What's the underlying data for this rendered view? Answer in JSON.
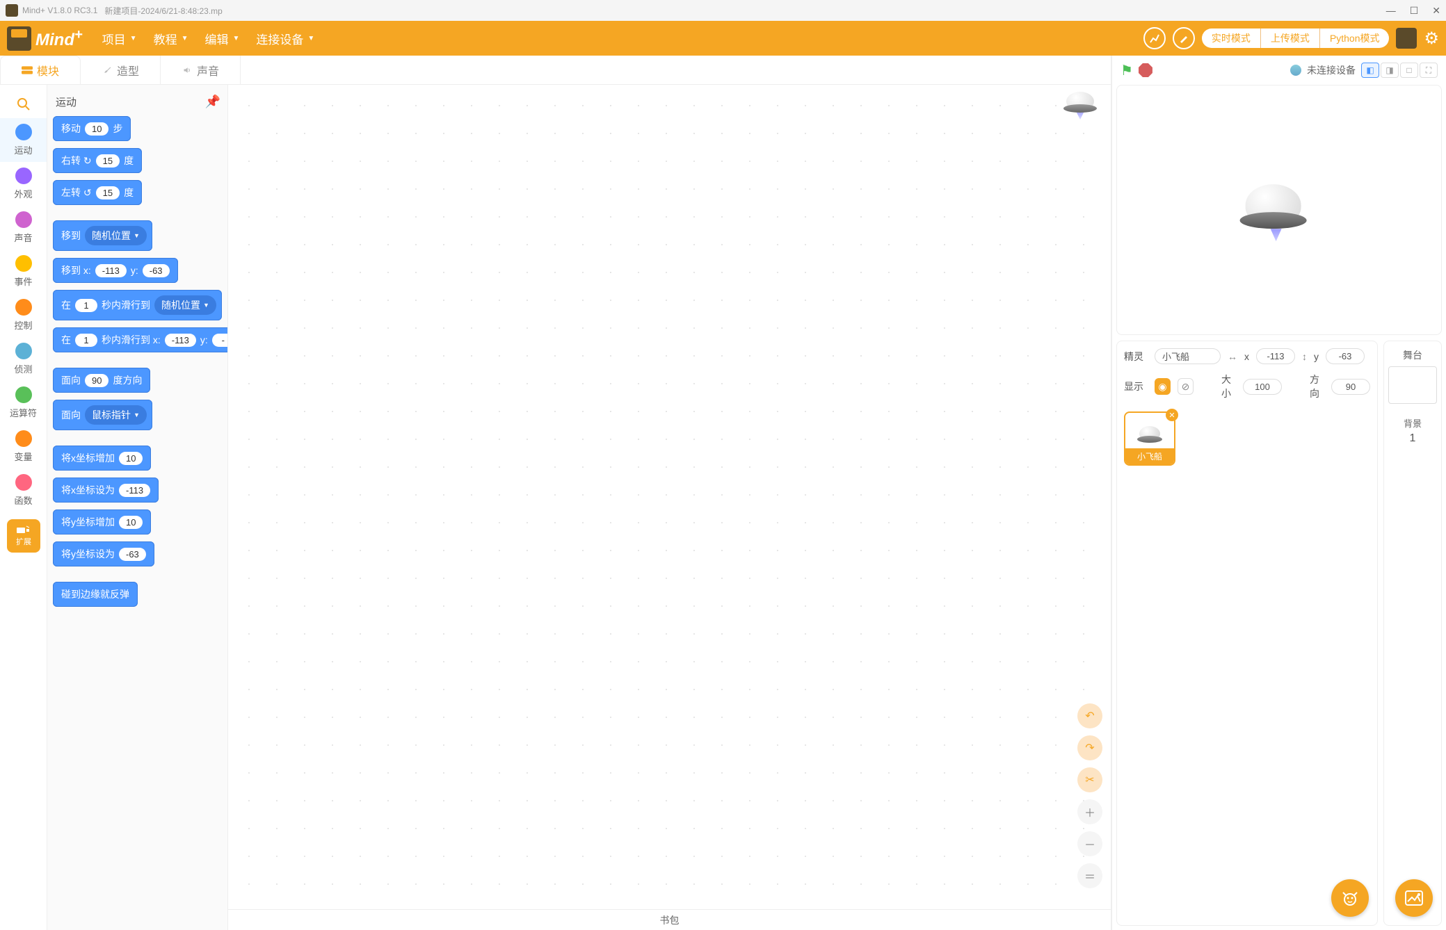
{
  "titlebar": {
    "app": "Mind+ V1.8.0 RC3.1",
    "file": "新建项目-2024/6/21-8:48:23.mp"
  },
  "menu": {
    "items": [
      "项目",
      "教程",
      "编辑",
      "连接设备"
    ]
  },
  "modes": {
    "realtime": "实时模式",
    "upload": "上传模式",
    "python": "Python模式"
  },
  "tabs": {
    "blocks": "模块",
    "costumes": "造型",
    "sounds": "声音"
  },
  "categories": [
    {
      "name": "运动",
      "color": "#4c97ff"
    },
    {
      "name": "外观",
      "color": "#9966ff"
    },
    {
      "name": "声音",
      "color": "#cf63cf"
    },
    {
      "name": "事件",
      "color": "#ffbf00"
    },
    {
      "name": "控制",
      "color": "#ff8c1a"
    },
    {
      "name": "侦测",
      "color": "#5cb1d6"
    },
    {
      "name": "运算符",
      "color": "#59c059"
    },
    {
      "name": "变量",
      "color": "#ff8c1a"
    },
    {
      "name": "函数",
      "color": "#ff6680"
    }
  ],
  "ext_label": "扩展",
  "palette": {
    "title": "运动",
    "blocks": {
      "move": {
        "pre": "移动",
        "val": "10",
        "post": "步"
      },
      "turn_r": {
        "pre": "右转 ↻",
        "val": "15",
        "post": "度"
      },
      "turn_l": {
        "pre": "左转 ↺",
        "val": "15",
        "post": "度"
      },
      "goto_dd": {
        "pre": "移到",
        "dd": "随机位置"
      },
      "goto_xy": {
        "pre": "移到 x:",
        "x": "-113",
        "mid": "y:",
        "y": "-63"
      },
      "glide_dd": {
        "pre": "在",
        "sec": "1",
        "mid": "秒内滑行到",
        "dd": "随机位置"
      },
      "glide_xy": {
        "pre": "在",
        "sec": "1",
        "mid": "秒内滑行到 x:",
        "x": "-113",
        "mid2": "y:",
        "y": "-"
      },
      "point_dir": {
        "pre": "面向",
        "val": "90",
        "post": "度方向"
      },
      "point_to": {
        "pre": "面向",
        "dd": "鼠标指针"
      },
      "change_x": {
        "pre": "将x坐标增加",
        "val": "10"
      },
      "set_x": {
        "pre": "将x坐标设为",
        "val": "-113"
      },
      "change_y": {
        "pre": "将y坐标增加",
        "val": "10"
      },
      "set_y": {
        "pre": "将y坐标设为",
        "val": "-63"
      },
      "bounce": {
        "pre": "碰到边缘就反弹"
      }
    }
  },
  "backpack": "书包",
  "stage_header": {
    "disconnected": "未连接设备"
  },
  "sprite_info": {
    "label_sprite": "精灵",
    "name": "小飞船",
    "label_x": "x",
    "x": "-113",
    "label_y": "y",
    "y": "-63",
    "label_show": "显示",
    "label_size": "大小",
    "size": "100",
    "label_dir": "方向",
    "dir": "90"
  },
  "sprite_tile": {
    "name": "小飞船"
  },
  "stage_col": {
    "header": "舞台",
    "bk_label": "背景",
    "bk_count": "1"
  }
}
